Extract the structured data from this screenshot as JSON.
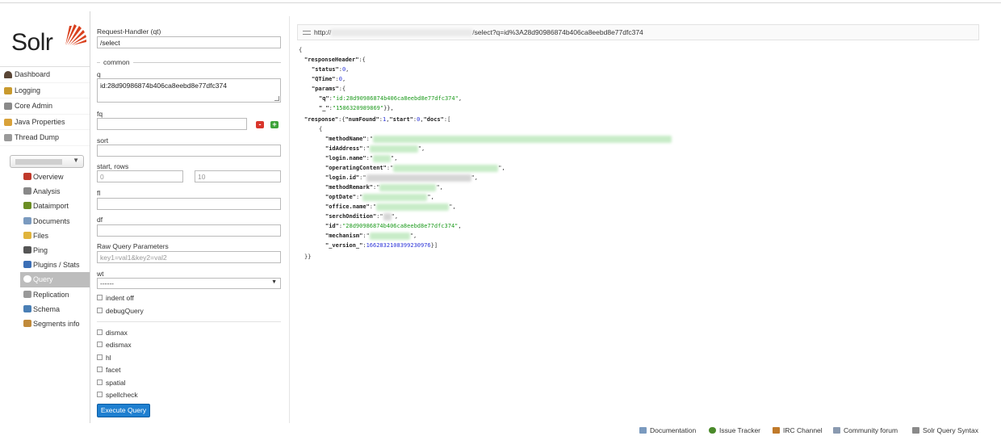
{
  "nav": {
    "logo_text": "Solr",
    "main_items": [
      {
        "label": "Dashboard",
        "icon": "dashboard-icon",
        "color": "#5a4636"
      },
      {
        "label": "Logging",
        "icon": "logging-icon",
        "color": "#c99a2e"
      },
      {
        "label": "Core Admin",
        "icon": "core-admin-icon",
        "color": "#8a8a8a"
      },
      {
        "label": "Java Properties",
        "icon": "java-icon",
        "color": "#d9a23a"
      },
      {
        "label": "Thread Dump",
        "icon": "thread-dump-icon",
        "color": "#9a9a9a"
      }
    ],
    "core_items": [
      {
        "label": "Overview",
        "icon": "overview-icon",
        "color": "#c0392b",
        "active": false
      },
      {
        "label": "Analysis",
        "icon": "analysis-icon",
        "color": "#888888",
        "active": false
      },
      {
        "label": "Dataimport",
        "icon": "dataimport-icon",
        "color": "#6b8e23",
        "active": false
      },
      {
        "label": "Documents",
        "icon": "documents-icon",
        "color": "#7a9abf",
        "active": false
      },
      {
        "label": "Files",
        "icon": "files-icon",
        "color": "#e0b43c",
        "active": false
      },
      {
        "label": "Ping",
        "icon": "ping-icon",
        "color": "#555555",
        "active": false
      },
      {
        "label": "Plugins / Stats",
        "icon": "plugins-icon",
        "color": "#3b6fb6",
        "active": false
      },
      {
        "label": "Query",
        "icon": "query-icon",
        "color": "#ffffff",
        "active": true
      },
      {
        "label": "Replication",
        "icon": "replication-icon",
        "color": "#999999",
        "active": false
      },
      {
        "label": "Schema",
        "icon": "schema-icon",
        "color": "#4a7fb5",
        "active": false
      },
      {
        "label": "Segments info",
        "icon": "segments-icon",
        "color": "#c08a3a",
        "active": false
      }
    ]
  },
  "form": {
    "qt_label": "Request-Handler (qt)",
    "qt_value": "/select",
    "common_legend": "common",
    "q_label": "q",
    "q_value": "id:28d90986874b406ca8eebd8e77dfc374",
    "fq_label": "fq",
    "fq_value": "",
    "sort_label": "sort",
    "sort_value": "",
    "start_rows_label": "start, rows",
    "start_value": "0",
    "rows_value": "10",
    "fl_label": "fl",
    "fl_value": "",
    "df_label": "df",
    "df_value": "",
    "raw_label": "Raw Query Parameters",
    "raw_placeholder": "key1=val1&key2=val2",
    "wt_label": "wt",
    "wt_value": "------",
    "indent_label": "indent off",
    "debug_label": "debugQuery",
    "options": [
      "dismax",
      "edismax",
      "hl",
      "facet",
      "spatial",
      "spellcheck"
    ],
    "execute_label": "Execute Query",
    "remove_label": "-",
    "add_label": "+"
  },
  "result": {
    "url_prefix": "http://",
    "url_suffix": "/select?q=id%3A28d90986874b406ca8eebd8e77dfc374",
    "json": {
      "open_brace": "{",
      "responseHeader_key": "\"responseHeader\"",
      "status_key": "\"status\"",
      "status_val": "0",
      "qtime_key": "\"QTime\"",
      "qtime_val": "0",
      "params_key": "\"params\"",
      "q_key": "\"q\"",
      "q_val": "\"id:28d90986874b406ca8eebd8e77dfc374\"",
      "underscore_key": "\"_\"",
      "underscore_val": "\"1586320989869\"",
      "response_key": "\"response\"",
      "numFound_key": "\"numFound\"",
      "numFound_val": "1",
      "start_key": "\"start\"",
      "start_val": "0",
      "docs_key": "\"docs\"",
      "doc_open": "{",
      "methodName_key": "\"methodName\"",
      "idAddress_key": "\"idAddress\"",
      "loginname_key": "\"login.name\"",
      "operatingContent_key": "\"operatingContent\"",
      "loginid_key": "\"login.id\"",
      "methodRemark_key": "\"methodRemark\"",
      "optDate_key": "\"optDate\"",
      "officename_key": "\"office.name\"",
      "serchOndition_key": "\"serchOndition\"",
      "id_key": "\"id\"",
      "id_val": "\"28d90986874b406ca8eebd8e77dfc374\"",
      "mechanism_key": "\"mechanism\"",
      "version_key": "\"_version_\"",
      "version_val": "1662832108399230976",
      "close_docs": "}]",
      "close_all": "}}"
    }
  },
  "footer": {
    "links": [
      {
        "label": "Documentation",
        "icon": "documentation-icon",
        "color": "#7a9abf"
      },
      {
        "label": "Issue Tracker",
        "icon": "issue-tracker-icon",
        "color": "#4a8a2a"
      },
      {
        "label": "IRC Channel",
        "icon": "irc-channel-icon",
        "color": "#c07a2a"
      },
      {
        "label": "Community forum",
        "icon": "community-forum-icon",
        "color": "#8a9ab0"
      },
      {
        "label": "Solr Query Syntax",
        "icon": "query-syntax-icon",
        "color": "#8a8a8a"
      }
    ]
  }
}
